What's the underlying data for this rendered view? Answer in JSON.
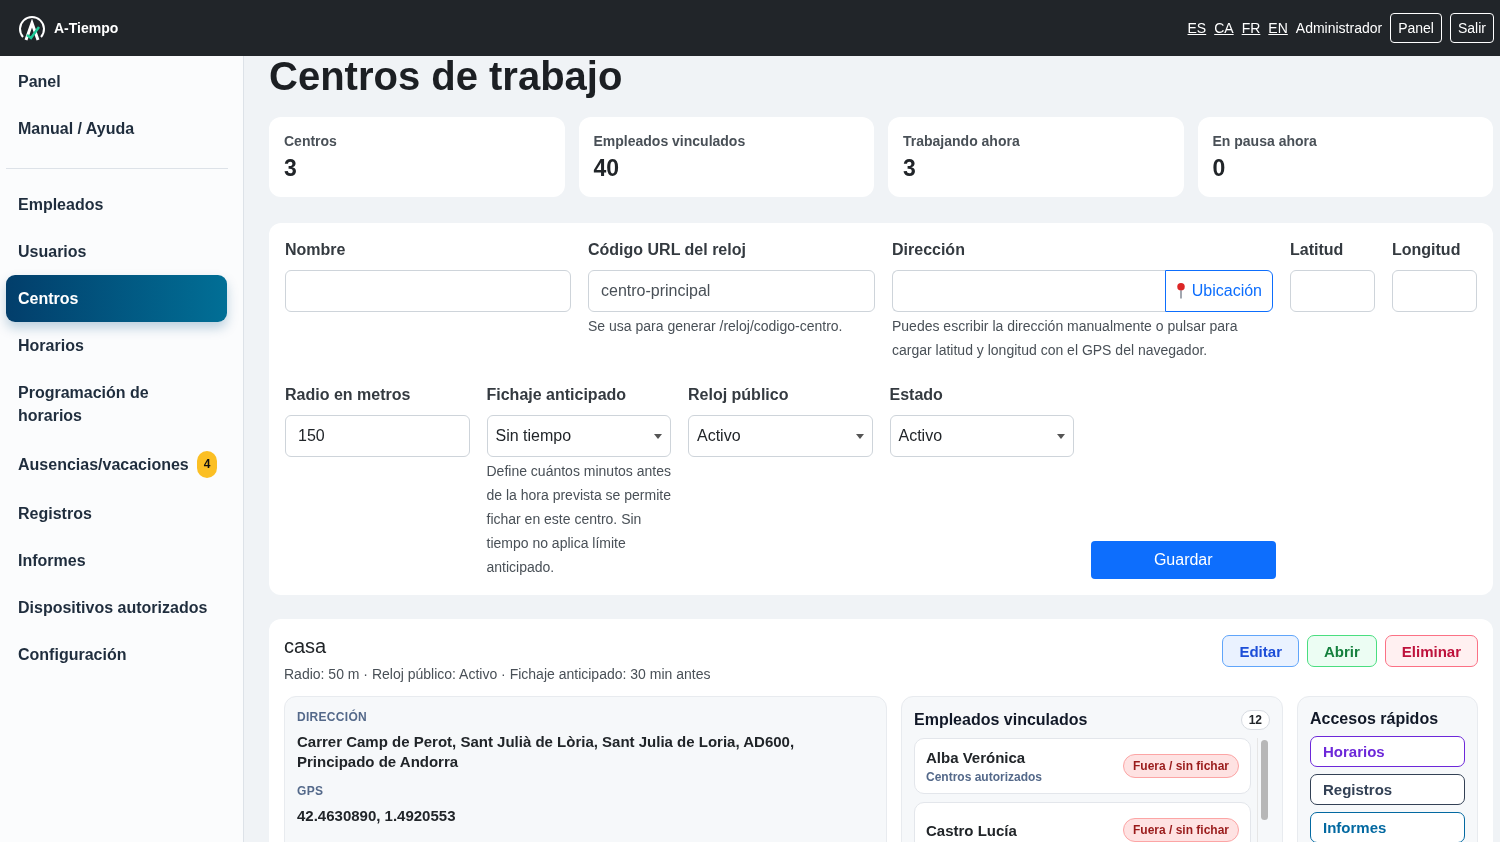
{
  "header": {
    "brand": "A-Tiempo",
    "languages": [
      {
        "label": "ES"
      },
      {
        "label": "CA"
      },
      {
        "label": "FR"
      },
      {
        "label": "EN"
      }
    ],
    "user": "Administrador",
    "buttons": [
      "Panel",
      "Salir"
    ]
  },
  "sidebar": {
    "sections": [
      [
        {
          "label": "Panel",
          "selected": false
        },
        {
          "label": "Manual / Ayuda",
          "selected": false
        }
      ],
      [
        {
          "label": "Empleados",
          "selected": false
        },
        {
          "label": "Usuarios",
          "selected": false
        },
        {
          "label": "Centros",
          "selected": true
        },
        {
          "label": "Horarios",
          "selected": false
        },
        {
          "label": "Programación de horarios",
          "selected": false
        },
        {
          "label": "Ausencias/vacaciones",
          "selected": false,
          "badge": "4"
        },
        {
          "label": "Registros",
          "selected": false
        },
        {
          "label": "Informes",
          "selected": false
        },
        {
          "label": "Dispositivos autorizados",
          "selected": false
        },
        {
          "label": "Configuración",
          "selected": false
        }
      ]
    ]
  },
  "page_title": "Centros de trabajo",
  "stats": [
    {
      "label": "Centros",
      "value": "3"
    },
    {
      "label": "Empleados vinculados",
      "value": "40"
    },
    {
      "label": "Trabajando ahora",
      "value": "3"
    },
    {
      "label": "En pausa ahora",
      "value": "0"
    }
  ],
  "form": {
    "top_fields": [
      {
        "kind": "text",
        "label": "Nombre"
      },
      {
        "kind": "text",
        "label": "Código URL del reloj",
        "placeholder": "centro-principal",
        "hint": "Se usa para generar /reloj/codigo-centro."
      },
      {
        "kind": "address",
        "label": "Dirección",
        "button": "Ubicación",
        "hint": "Puedes escribir la dirección manualmente o pulsar para cargar latitud y longitud con el GPS del navegador."
      },
      {
        "kind": "text",
        "label": "Latitud"
      },
      {
        "kind": "text",
        "label": "Longitud"
      }
    ],
    "bottom_fields": [
      {
        "kind": "text",
        "label": "Radio en metros",
        "value": "150"
      },
      {
        "kind": "select",
        "label": "Fichaje anticipado",
        "value": "Sin tiempo",
        "hint": "Define cuántos minutos antes de la hora prevista se permite fichar en este centro. Sin tiempo no aplica límite anticipado."
      },
      {
        "kind": "select",
        "label": "Reloj público",
        "value": "Activo"
      },
      {
        "kind": "select",
        "label": "Estado",
        "value": "Activo"
      }
    ],
    "submit": "Guardar"
  },
  "centers": [
    {
      "name": "casa",
      "meta": "Radio: 50 m · Reloj público: Activo · Fichaje anticipado: 30 min antes",
      "actions": [
        {
          "label": "Editar",
          "kind": "edit"
        },
        {
          "label": "Abrir",
          "kind": "open"
        },
        {
          "label": "Eliminar",
          "kind": "delete"
        }
      ],
      "address_label": "DIRECCIÓN",
      "address": "Carrer Camp de Perot, Sant Julià de Lòria, Sant Julia de Loria, AD600, Principado de Andorra",
      "gps_label": "GPS",
      "gps": "42.4630890, 1.4920553",
      "employees": {
        "title": "Empleados vinculados",
        "count": "12",
        "items": [
          {
            "name": "Alba Verónica",
            "sub": "Centros autorizados",
            "status": "Fuera / sin fichar"
          },
          {
            "name": "Castro Lucía",
            "status": "Fuera / sin fichar"
          }
        ]
      },
      "quick_access": {
        "title": "Accesos rápidos",
        "links": [
          {
            "label": "Horarios",
            "color": "#6d28d9"
          },
          {
            "label": "Registros",
            "color": "#334155"
          },
          {
            "label": "Informes",
            "color": "#0369a1"
          }
        ]
      }
    }
  ]
}
